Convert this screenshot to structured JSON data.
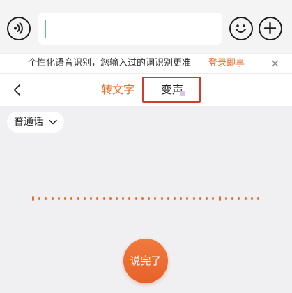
{
  "input": {
    "placeholder": "",
    "caret_color": "#5cc48a"
  },
  "icons": {
    "voice": "voice-wave-icon",
    "emoji": "smiley-icon",
    "plus": "plus-icon",
    "close": "close-icon",
    "back": "chevron-left-icon",
    "dropdown": "chevron-down-icon"
  },
  "hint": {
    "text": "个性化语音识别，您输入过的词识别更准",
    "link": "登录即享",
    "close": "×"
  },
  "tabs": {
    "items": [
      {
        "label": "转文字",
        "active": true
      },
      {
        "label": "变声",
        "active": false
      }
    ]
  },
  "language": {
    "selected": "普通话"
  },
  "waveform": {
    "dot_count": 36,
    "tall_dots": [
      0,
      29
    ]
  },
  "done_button": {
    "label": "说完了"
  },
  "colors": {
    "accent": "#e8702e",
    "highlight_border": "#d43a2f",
    "background": "#f0f0f3"
  }
}
